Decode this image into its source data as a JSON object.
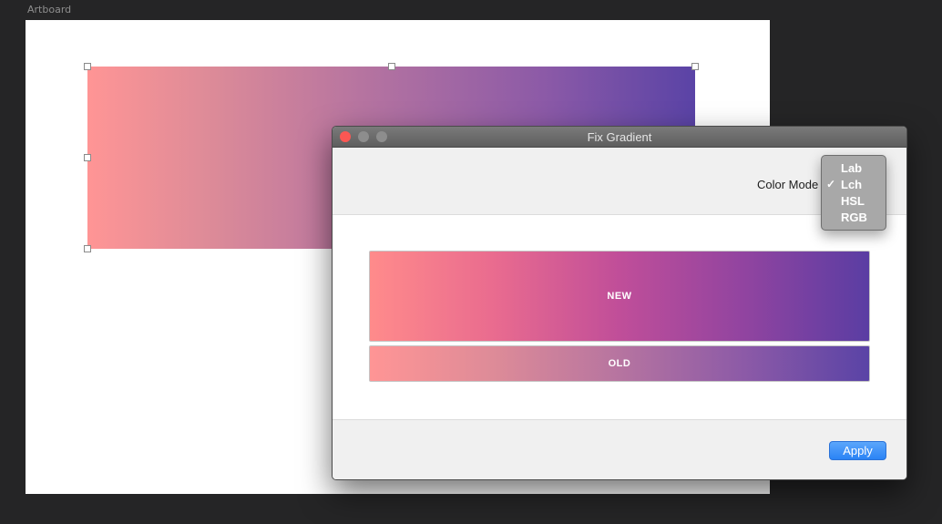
{
  "artboard": {
    "label": "Artboard"
  },
  "dialog": {
    "title": "Fix Gradient",
    "color_mode_label": "Color Mode",
    "preview_new_label": "NEW",
    "preview_old_label": "OLD",
    "apply_label": "Apply"
  },
  "color_mode_menu": {
    "items": [
      {
        "label": "Lab",
        "checked": false
      },
      {
        "label": "Lch",
        "checked": true
      },
      {
        "label": "HSL",
        "checked": false
      },
      {
        "label": "RGB",
        "checked": false
      }
    ],
    "check_glyph": "✓"
  },
  "colors": {
    "accent": "#2a83f5",
    "close_button": "#fc5753",
    "gradient_start": "#ff9595",
    "gradient_end": "#5a43a6"
  }
}
